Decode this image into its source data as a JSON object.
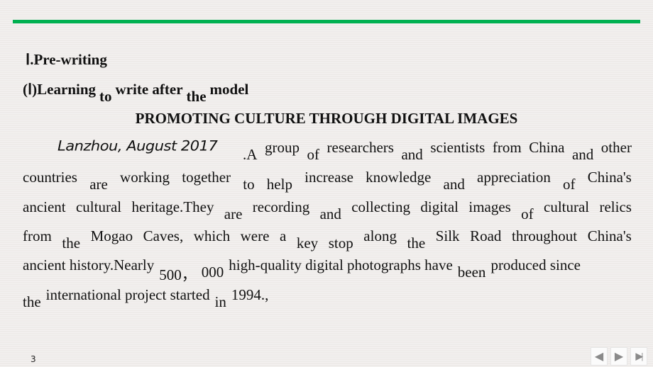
{
  "section_heading": "Ⅰ.Pre-writing",
  "subheading": {
    "parts": [
      {
        "text": "(Ⅰ)Learning",
        "low": false
      },
      {
        "text": "to",
        "low": true
      },
      {
        "text": "write after",
        "low": false
      },
      {
        "text": "the",
        "low": true
      },
      {
        "text": "model",
        "low": false
      }
    ]
  },
  "article_title": "PROMOTING CULTURE THROUGH DIGITAL IMAGES",
  "handwritten_dateline": "Lanzhou, August 2017",
  "body_lines": [
    [
      {
        "text": ".A",
        "low": true
      },
      {
        "text": "group",
        "low": false
      },
      {
        "text": "of",
        "low": true
      },
      {
        "text": "researchers",
        "low": false
      },
      {
        "text": "and",
        "low": true
      },
      {
        "text": "scientists",
        "low": false
      },
      {
        "text": "from",
        "low": false
      },
      {
        "text": "China",
        "low": false
      },
      {
        "text": "and",
        "low": true
      },
      {
        "text": "other",
        "low": false
      }
    ],
    [
      {
        "text": "countries",
        "low": false
      },
      {
        "text": "are",
        "low": true
      },
      {
        "text": "working",
        "low": false
      },
      {
        "text": "together",
        "low": false
      },
      {
        "text": "to",
        "low": true
      },
      {
        "text": "help",
        "low": true
      },
      {
        "text": "increase",
        "low": false
      },
      {
        "text": "knowledge",
        "low": false
      },
      {
        "text": "and",
        "low": true
      },
      {
        "text": "appreciation",
        "low": false
      },
      {
        "text": "of",
        "low": true
      },
      {
        "text": "China's",
        "low": false
      }
    ],
    [
      {
        "text": "ancient",
        "low": false
      },
      {
        "text": "cultural",
        "low": false
      },
      {
        "text": "heritage.They",
        "low": false
      },
      {
        "text": "are",
        "low": true
      },
      {
        "text": "recording",
        "low": false
      },
      {
        "text": "and",
        "low": true
      },
      {
        "text": "collecting",
        "low": false
      },
      {
        "text": "digital",
        "low": false
      },
      {
        "text": "images",
        "low": false
      },
      {
        "text": "of",
        "low": true
      },
      {
        "text": "cultural",
        "low": false
      },
      {
        "text": "relics",
        "low": false
      }
    ],
    [
      {
        "text": "from",
        "low": false
      },
      {
        "text": "the",
        "low": true
      },
      {
        "text": "Mogao",
        "low": false
      },
      {
        "text": "Caves,",
        "low": false
      },
      {
        "text": "which",
        "low": false
      },
      {
        "text": "were",
        "low": false
      },
      {
        "text": "a",
        "low": false
      },
      {
        "text": "key",
        "low": true
      },
      {
        "text": "stop",
        "low": true
      },
      {
        "text": "along",
        "low": false
      },
      {
        "text": "the",
        "low": true
      },
      {
        "text": "Silk",
        "low": false
      },
      {
        "text": "Road",
        "low": false
      },
      {
        "text": "throughout",
        "low": false
      },
      {
        "text": "China's",
        "low": false
      }
    ],
    [
      {
        "text": "ancient history.Nearly",
        "low": false
      },
      {
        "text": "500，",
        "low": true
      },
      {
        "text": "000",
        "low": true
      },
      {
        "text": "high-quality digital photographs have",
        "low": false
      },
      {
        "text": "been",
        "low": true
      },
      {
        "text": "produced since",
        "low": false
      }
    ],
    [
      {
        "text": "the",
        "low": true
      },
      {
        "text": "international project started",
        "low": false
      },
      {
        "text": "in",
        "low": true
      },
      {
        "text": "1994.,",
        "low": false
      }
    ]
  ],
  "page_number": "3",
  "navigation": {
    "prev_icon": "◀",
    "next_icon": "▶",
    "end_icon": "▶|"
  },
  "colors": {
    "accent_rule": "#00b050",
    "background": "#f1eeec"
  }
}
